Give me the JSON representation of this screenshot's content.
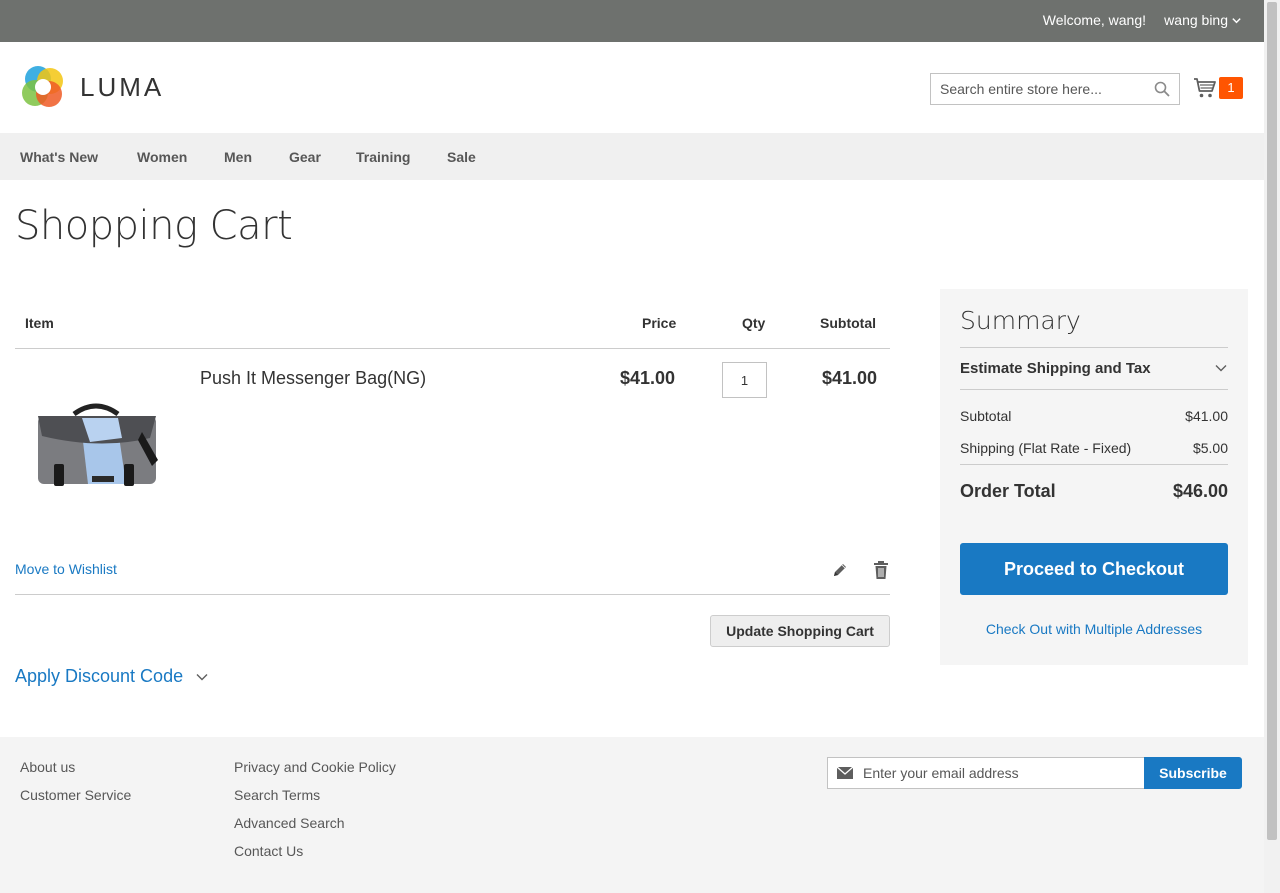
{
  "topbar": {
    "welcome": "Welcome, wang!",
    "account_name": "wang bing"
  },
  "header": {
    "logo_text": "LUMA",
    "search_placeholder": "Search entire store here...",
    "cart_count": "1"
  },
  "nav": {
    "items": [
      "What's New",
      "Women",
      "Men",
      "Gear",
      "Training",
      "Sale"
    ]
  },
  "page_title": "Shopping Cart",
  "cart": {
    "headers": {
      "item": "Item",
      "price": "Price",
      "qty": "Qty",
      "subtotal": "Subtotal"
    },
    "items": [
      {
        "name": "Push It Messenger Bag(NG)",
        "price": "$41.00",
        "qty": "1",
        "subtotal": "$41.00",
        "move_to_wishlist": "Move to Wishlist"
      }
    ],
    "update_label": "Update Shopping Cart",
    "discount_label": "Apply Discount Code"
  },
  "summary": {
    "title": "Summary",
    "estimate_label": "Estimate Shipping and Tax",
    "subtotal_label": "Subtotal",
    "subtotal_value": "$41.00",
    "shipping_label": "Shipping (Flat Rate - Fixed)",
    "shipping_value": "$5.00",
    "total_label": "Order Total",
    "total_value": "$46.00",
    "checkout_label": "Proceed to Checkout",
    "multi_label": "Check Out with Multiple Addresses"
  },
  "footer": {
    "col1": [
      "About us",
      "Customer Service"
    ],
    "col2": [
      "Privacy and Cookie Policy",
      "Search Terms",
      "Advanced Search",
      "Contact Us"
    ],
    "email_placeholder": "Enter your email address",
    "subscribe_label": "Subscribe"
  },
  "colors": {
    "accent": "#1979c3",
    "cart_badge": "#ff5501",
    "topbar": "#6e716e"
  }
}
